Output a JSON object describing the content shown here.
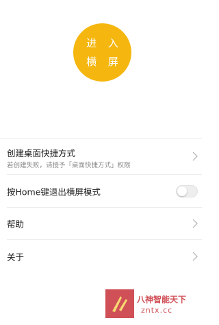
{
  "enter_button": {
    "line1": "进 入",
    "line2": "横 屏"
  },
  "colors": {
    "accent": "#f5b70f",
    "watermark": "#c8323a"
  },
  "list": {
    "shortcut": {
      "title": "创建桌面快捷方式",
      "subtitle": "若创建失败，请授予「桌面快捷方式」权限",
      "icon": "chevron-right-icon"
    },
    "home_exit": {
      "title": "按Home键退出横屏模式",
      "toggle_on": false
    },
    "help": {
      "title": "帮助",
      "icon": "chevron-right-icon"
    },
    "about": {
      "title": "关于",
      "icon": "chevron-right-icon"
    }
  },
  "watermark": {
    "name": "八神智能天下",
    "domain": "zntx.cc"
  }
}
